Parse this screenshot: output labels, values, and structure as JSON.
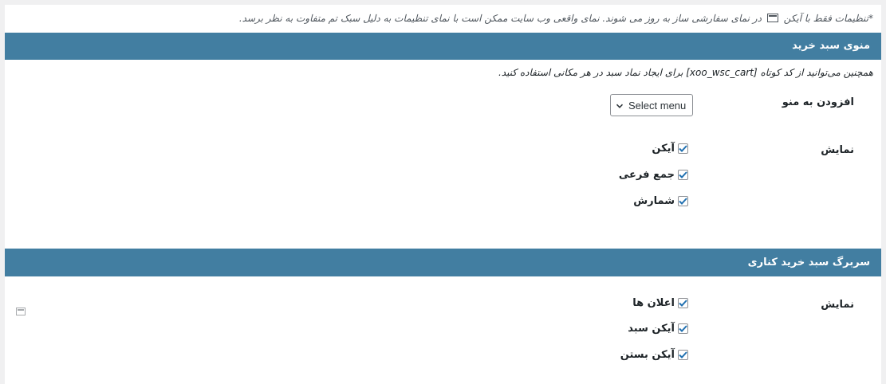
{
  "notice": {
    "before_icon": "*تنظیمات فقط با آیکن",
    "after_icon": "در نمای سفارشی ساز به روز می شوند. نمای واقعی وب سایت ممکن است با نمای تنظیمات به دلیل سبک تم متفاوت به نظر برسد.",
    "icon": "customizer-icon"
  },
  "section1": {
    "title": "منوی سبد خرید",
    "description": "همچنین می‌توانید از کد کوتاه [xoo_wsc_cart] برای ایجاد نماد سبد در هر مکانی استفاده کنید.",
    "menu_label": "افزودن به منو",
    "menu_select_value": "Select menu",
    "display_label": "نمایش",
    "options": [
      {
        "label": "آیکن",
        "checked": true
      },
      {
        "label": "جمع فرعی",
        "checked": true
      },
      {
        "label": "شمارش",
        "checked": true
      }
    ]
  },
  "section2": {
    "title": "سربرگ سبد خرید کناری",
    "display_label": "نمایش",
    "options": [
      {
        "label": "اعلان ها",
        "checked": true
      },
      {
        "label": "آیکن سبد",
        "checked": true
      },
      {
        "label": "آیکن بستن",
        "checked": true
      }
    ]
  },
  "colors": {
    "header_bg": "#427ea1",
    "checkbox_tick": "#2271b1"
  }
}
